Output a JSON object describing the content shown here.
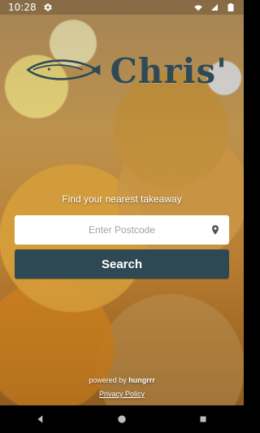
{
  "status_bar": {
    "time": "10:28",
    "icons": [
      "settings-icon",
      "wifi-icon",
      "signal-icon",
      "battery-icon"
    ]
  },
  "brand": {
    "name": "Chris'",
    "logo_icon": "fish-logo-icon",
    "color": "#2f4a56"
  },
  "finder": {
    "title": "Find your nearest takeaway",
    "postcode_placeholder": "Enter Postcode",
    "postcode_value": "",
    "location_icon": "location-pin-icon",
    "search_label": "Search",
    "search_color": "#2e4954"
  },
  "footer": {
    "powered_by_prefix": "powered by",
    "powered_by_brand": "hungrrr",
    "privacy_label": "Privacy Policy"
  },
  "nav_bar": {
    "buttons": [
      "back-icon",
      "home-icon",
      "recents-icon"
    ]
  }
}
